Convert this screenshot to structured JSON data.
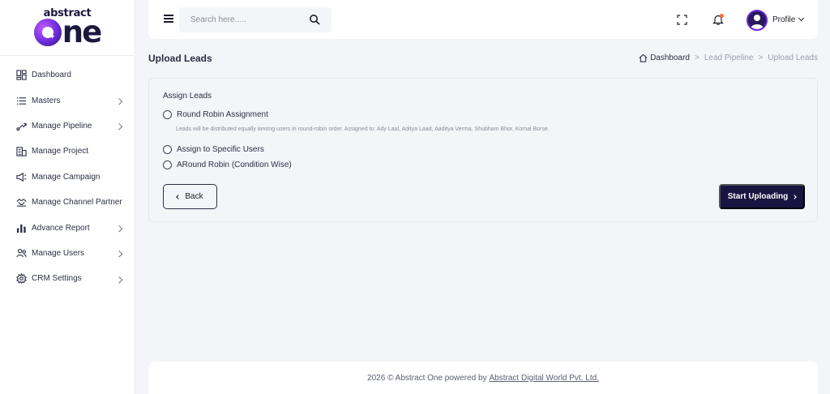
{
  "brand": {
    "top": "abstract",
    "bottom": "ne"
  },
  "sidebar": {
    "items": [
      {
        "label": "Dashboard",
        "icon": "dashboard-icon",
        "has_children": false
      },
      {
        "label": "Masters",
        "icon": "list-icon",
        "has_children": true
      },
      {
        "label": "Manage Pipeline",
        "icon": "pipeline-icon",
        "has_children": true
      },
      {
        "label": "Manage Project",
        "icon": "building-icon",
        "has_children": false
      },
      {
        "label": "Manage Campaign",
        "icon": "megaphone-icon",
        "has_children": false
      },
      {
        "label": "Manage Channel Partner",
        "icon": "handshake-icon",
        "has_children": false
      },
      {
        "label": "Advance Report",
        "icon": "bar-chart-icon",
        "has_children": true
      },
      {
        "label": "Manage Users",
        "icon": "users-icon",
        "has_children": true
      },
      {
        "label": "CRM Settings",
        "icon": "gear-icon",
        "has_children": true
      }
    ]
  },
  "header": {
    "search_placeholder": "Search here.....",
    "search_value": "",
    "profile_label": "Profile"
  },
  "page": {
    "title": "Upload Leads",
    "breadcrumb": [
      "Dashboard",
      "Lead Pipeline",
      "Upload Leads"
    ],
    "breadcrumb_sep": ">"
  },
  "assign": {
    "title": "Assign Leads",
    "options": [
      {
        "label": "Round Robin Assignment",
        "checked": false
      },
      {
        "label": "Assign to Specific Users",
        "checked": false
      },
      {
        "label": "ARound Robin (Condition Wise)",
        "checked": false
      }
    ],
    "round_robin_desc": "Leads will be distributed equally among users in round-robin order. Assigned to: Ady Laal, Aditya Laad, Aaditya Verma, Shubham Bhor, Komal Borse.",
    "back_label": "Back",
    "submit_label": "Start Uploading"
  },
  "footer": {
    "text": "2026 © Abstract One powered by",
    "link": "Abstract Digital World Pvt. Ltd."
  },
  "colors": {
    "primary": "#1a1440",
    "accent": "#6a2bd9",
    "notification": "#ff6a2b",
    "background": "#f4f5f8"
  }
}
